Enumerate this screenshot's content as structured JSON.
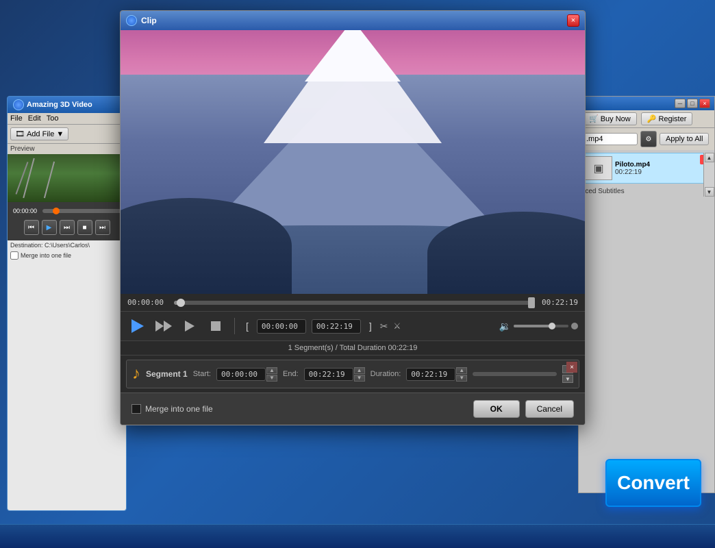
{
  "app": {
    "title": "Amazing 3D Video",
    "menu": [
      "File",
      "Edit",
      "Too"
    ],
    "add_file_label": "Add File",
    "buy_now_label": "Buy Now",
    "register_label": "Register",
    "apply_to_all_label": "Apply to All",
    "format_label": ".mp4",
    "file_item": {
      "name": "Piloto.mp4",
      "duration": "00:22:19",
      "forced_subs": "rced Subtitles"
    },
    "destination_label": "Destination:",
    "destination_path": "C:\\Users\\Carlos\\",
    "merge_label": "Merge into one file",
    "current_time": "00:00:00",
    "convert_label": "Convert"
  },
  "clip_dialog": {
    "title": "Clip",
    "close_label": "×",
    "time_start": "00:00:00",
    "time_end": "00:22:19",
    "seek_start": "00:00:00",
    "seek_end": "00:22:19",
    "segment_info": "1 Segment(s) / Total Duration 00:22:19",
    "segment1": {
      "label": "Segment 1",
      "start_label": "Start:",
      "start_value": "00:00:00",
      "end_label": "End:",
      "end_value": "00:22:19",
      "duration_label": "Duration:",
      "duration_value": "00:22:19"
    },
    "merge_label": "Merge into one file",
    "ok_label": "OK",
    "cancel_label": "Cancel"
  }
}
